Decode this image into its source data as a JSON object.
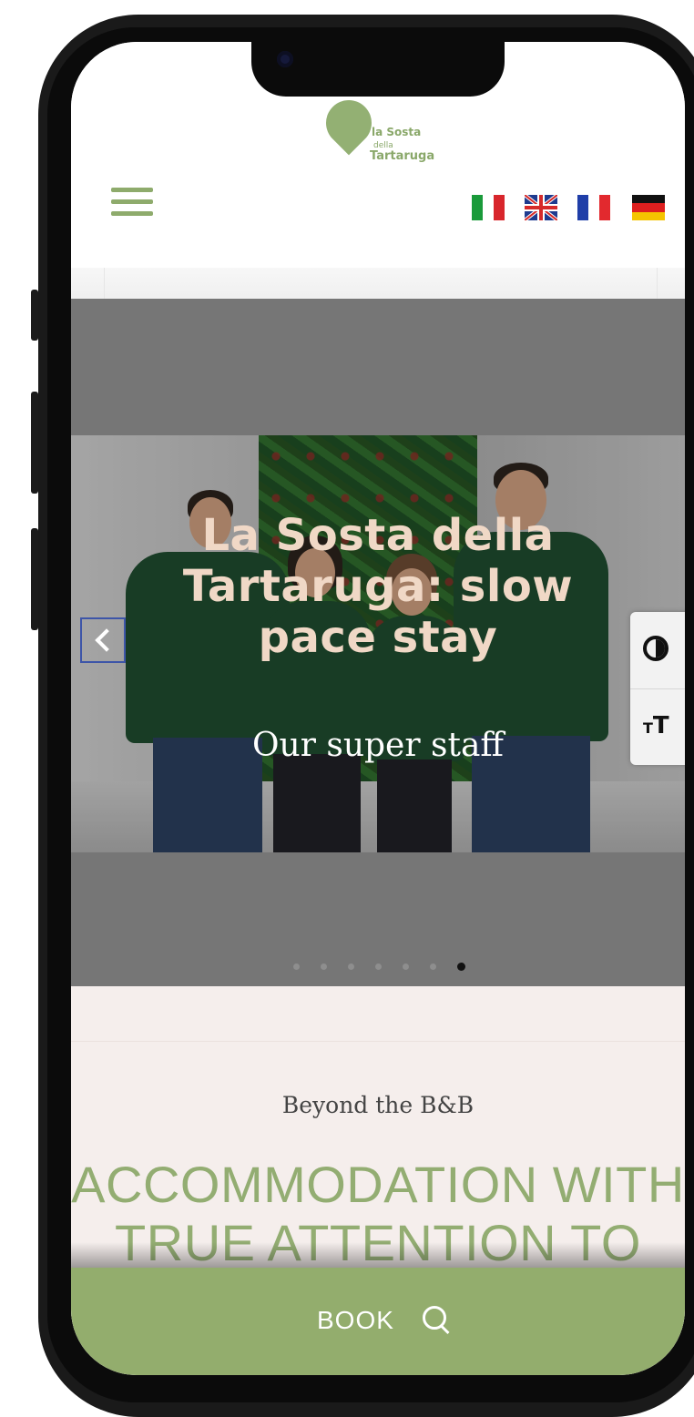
{
  "header": {
    "logo_text": {
      "line1": "la Sosta",
      "line2": "della",
      "line3": "Tartaruga"
    },
    "menu_icon": "hamburger-menu-icon",
    "languages": [
      "Italiano",
      "English",
      "Français",
      "Deutsch"
    ],
    "language_flags": [
      "it-flag-icon",
      "gb-flag-icon",
      "fr-flag-icon",
      "de-flag-icon"
    ]
  },
  "hero": {
    "title": "La Sosta della Tartaruga: slow pace stay",
    "subtitle": "Our super staff",
    "prev_icon": "chevron-left-icon",
    "slides_total": 7,
    "active_slide": 7
  },
  "accessibility": {
    "contrast_icon": "contrast-icon",
    "text_size_icon": "text-size-icon",
    "text_size_glyph": "T"
  },
  "section": {
    "eyebrow": "Beyond the B&B",
    "headline": "ACCOMMODATION WITH TRUE ATTENTION TO DETAIL"
  },
  "book_bar": {
    "label": "BOOK",
    "icon": "search-icon"
  },
  "colors": {
    "brand_green": "#93ad6d",
    "headline_green": "#93ad72",
    "hero_bg": "#767676",
    "section_bg": "#f5eeec",
    "hero_title": "#f0d8c6"
  }
}
